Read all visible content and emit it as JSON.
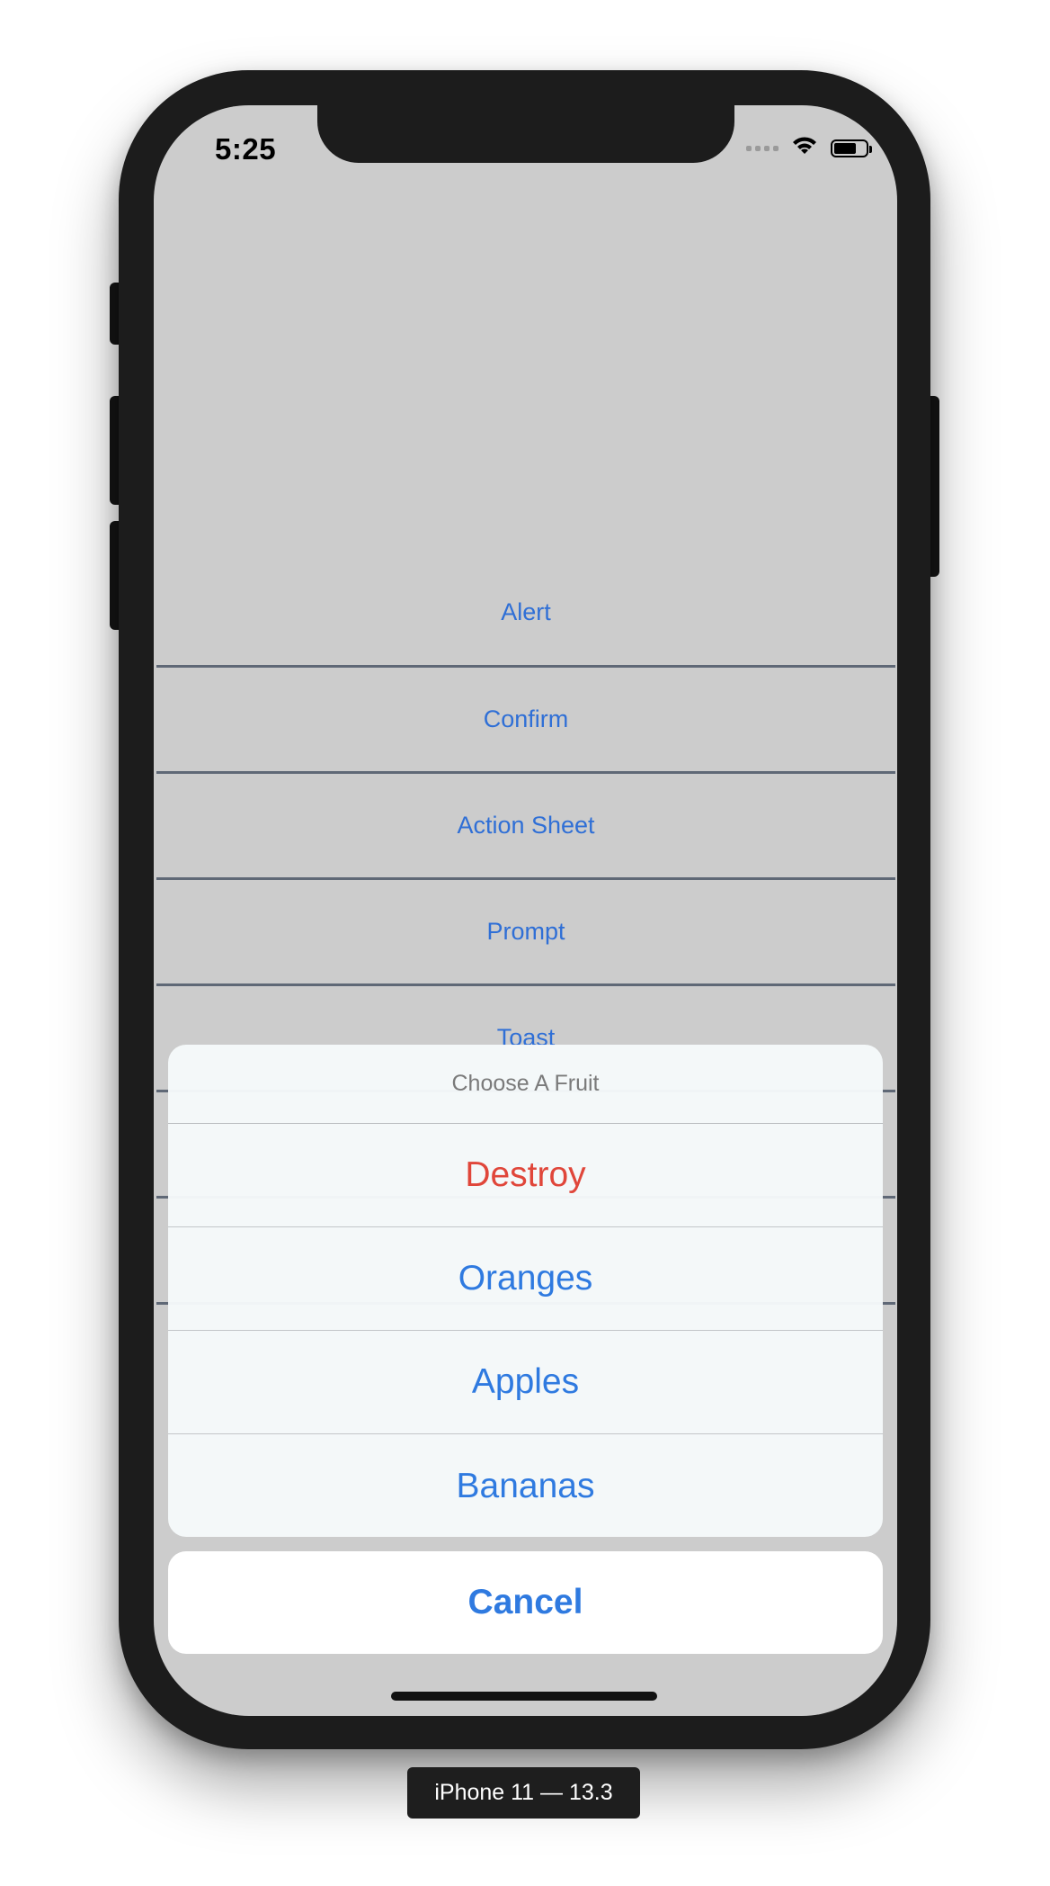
{
  "status_bar": {
    "time": "5:25"
  },
  "menu": {
    "items": [
      {
        "label": "Alert"
      },
      {
        "label": "Confirm"
      },
      {
        "label": "Action Sheet"
      },
      {
        "label": "Prompt"
      },
      {
        "label": "Toast"
      },
      {
        "label": ""
      },
      {
        "label": ""
      }
    ]
  },
  "action_sheet": {
    "title": "Choose A Fruit",
    "destructive_label": "Destroy",
    "options": [
      "Oranges",
      "Apples",
      "Bananas"
    ],
    "cancel_label": "Cancel"
  },
  "device_label": "iPhone 11 — 13.3",
  "colors": {
    "link_blue": "#2f7ae0",
    "destructive_red": "#e0463a",
    "screen_background": "#cccccc"
  }
}
